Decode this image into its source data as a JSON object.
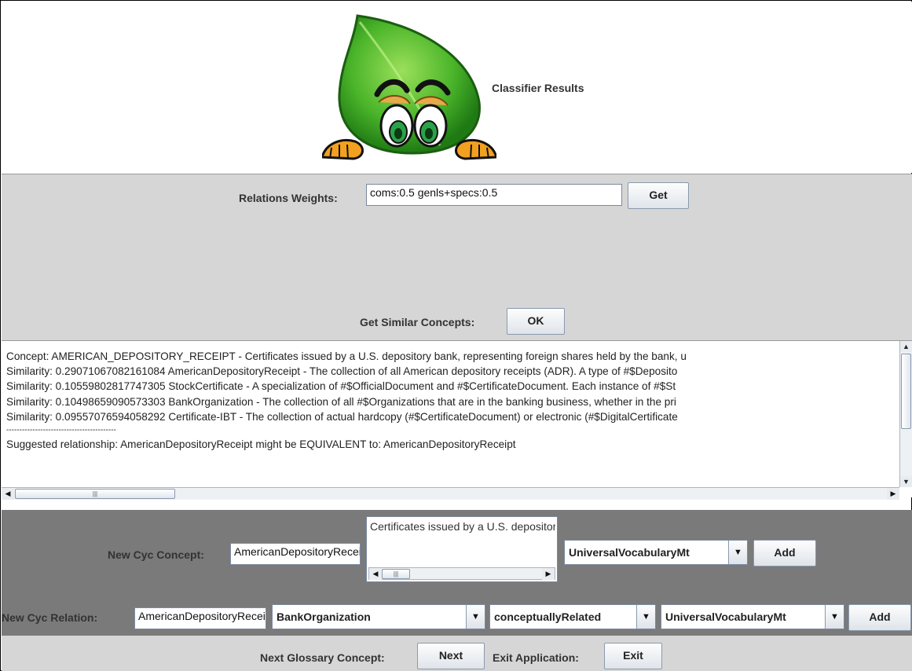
{
  "header": {
    "title": "Classifier Results"
  },
  "relations": {
    "label": "Relations Weights:",
    "value": "coms:0.5 genls+specs:0.5",
    "get_button": "Get"
  },
  "similar": {
    "label": "Get Similar Concepts:",
    "ok_button": "OK"
  },
  "results": {
    "lines": [
      "Concept: AMERICAN_DEPOSITORY_RECEIPT - Certificates issued by a U.S. depository bank, representing foreign shares held by the bank, u",
      "Similarity: 0.29071067082161084 AmericanDepositoryReceipt - The collection of all American depository receipts (ADR). A type of #$Deposito",
      "Similarity: 0.10559802817747305 StockCertificate - A specialization of #$OfficialDocument and #$CertificateDocument.  Each instance of #$St",
      "Similarity: 0.10498659090573303 BankOrganization - The collection of all #$Organizations that are in the banking business, whether in the pri",
      "Similarity: 0.09557076594058292 Certificate-IBT - The collection of actual hardcopy (#$CertificateDocument) or electronic  (#$DigitalCertificate",
      "------------------------------------------",
      "Suggested relationship: AmericanDepositoryReceipt might be EQUIVALENT to: AmericanDepositoryReceipt"
    ]
  },
  "new_concept": {
    "label": "New Cyc Concept:",
    "name_value": "AmericanDepositoryReceipt",
    "description_value": "Certificates issued by a U.S. depository bank",
    "mt_value": "UniversalVocabularyMt",
    "add_button": "Add"
  },
  "new_relation": {
    "label": "New Cyc Relation:",
    "name_value": "AmericanDepositoryReceipt",
    "target_value": "BankOrganization",
    "relation_value": "conceptuallyRelated",
    "mt_value": "UniversalVocabularyMt",
    "add_button": "Add"
  },
  "footer": {
    "next_label": "Next Glossary Concept:",
    "next_button": "Next",
    "exit_label": "Exit Application:",
    "exit_button": "Exit"
  },
  "icons": {
    "mascot": "leaf-mascot-icon",
    "dropdown": "chevron-down-icon"
  }
}
